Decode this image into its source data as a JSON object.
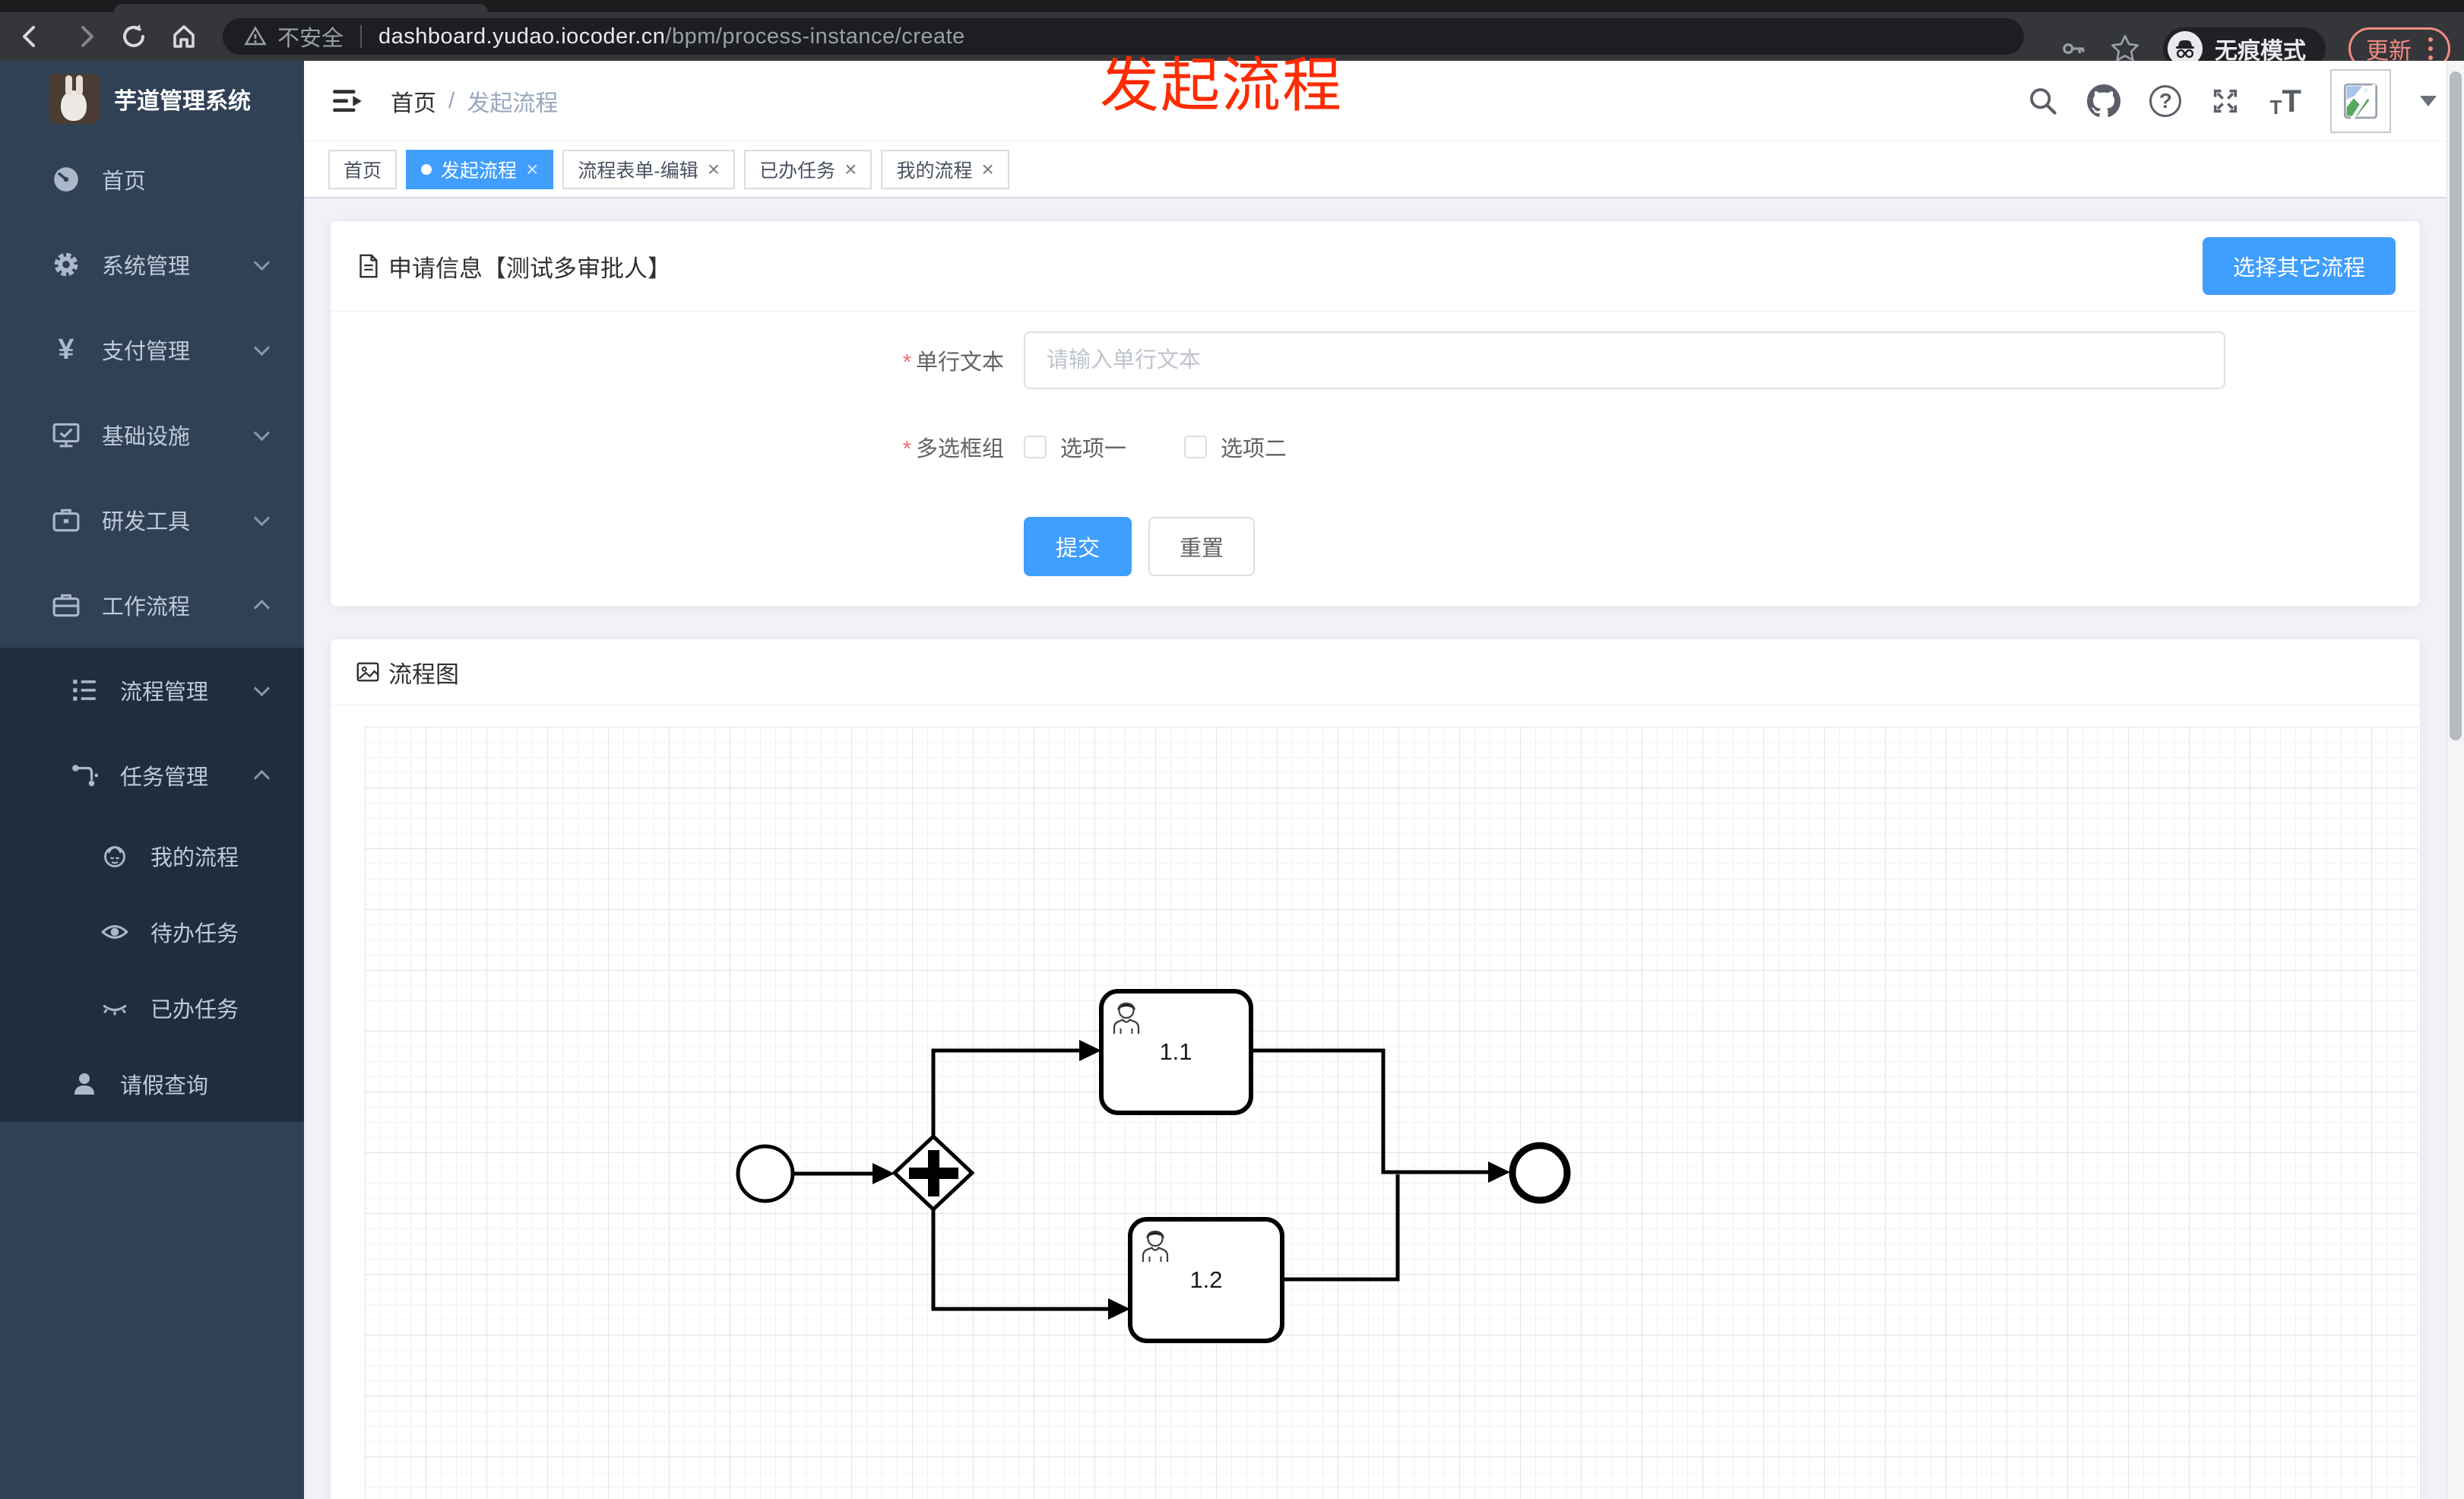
{
  "browser": {
    "security_label": "不安全",
    "url_domain": "dashboard.yudao.iocoder.cn",
    "url_path": "/bpm/process-instance/create",
    "incognito_label": "无痕模式",
    "update_label": "更新"
  },
  "annotation": {
    "text": "发起流程"
  },
  "colors": {
    "accent": "#409eff",
    "danger": "#f56c6c",
    "annotation_red": "#fe2b00",
    "sidebar_bg": "#304156",
    "submenu_bg": "#1f2d3d",
    "active_tab_bg": "#409eff"
  },
  "icons": {
    "question": "?",
    "close": "×",
    "yen": "¥",
    "font_t": "T"
  },
  "sidebar": {
    "app_title": "芋道管理系统",
    "menu": [
      {
        "label": "首页",
        "level": 1,
        "icon": "dashboard-icon"
      },
      {
        "label": "系统管理",
        "level": 1,
        "icon": "gear-icon",
        "state": "collapsed"
      },
      {
        "label": "支付管理",
        "level": 1,
        "icon": "yen-icon",
        "state": "collapsed"
      },
      {
        "label": "基础设施",
        "level": 1,
        "icon": "monitor-icon",
        "state": "collapsed"
      },
      {
        "label": "研发工具",
        "level": 1,
        "icon": "toolbox-icon",
        "state": "collapsed"
      },
      {
        "label": "工作流程",
        "level": 1,
        "icon": "briefcase-icon",
        "state": "expanded"
      },
      {
        "label": "流程管理",
        "level": 2,
        "icon": "tree-list-icon",
        "state": "collapsed"
      },
      {
        "label": "任务管理",
        "level": 2,
        "icon": "flow-icon",
        "state": "expanded"
      },
      {
        "label": "我的流程",
        "level": 3,
        "icon": "people-icon"
      },
      {
        "label": "待办任务",
        "level": 3,
        "icon": "eye-open-icon"
      },
      {
        "label": "已办任务",
        "level": 3,
        "icon": "eye-closed-icon"
      },
      {
        "label": "请假查询",
        "level": 2,
        "icon": "user-icon"
      }
    ]
  },
  "header": {
    "breadcrumb": [
      "首页",
      "发起流程"
    ],
    "breadcrumb_separator": "/"
  },
  "tabs": [
    {
      "label": "首页",
      "active": false,
      "closable": false
    },
    {
      "label": "发起流程",
      "active": true,
      "closable": true
    },
    {
      "label": "流程表单-编辑",
      "active": false,
      "closable": true
    },
    {
      "label": "已办任务",
      "active": false,
      "closable": true
    },
    {
      "label": "我的流程",
      "active": false,
      "closable": true
    }
  ],
  "form_card": {
    "title": "申请信息【测试多审批人】",
    "other_button": "选择其它流程",
    "required_mark": "*",
    "fields": [
      {
        "label": "单行文本",
        "required": true,
        "type": "text",
        "value": "",
        "placeholder": "请输入单行文本"
      },
      {
        "label": "多选框组",
        "required": true,
        "type": "checkbox-group",
        "options": [
          "选项一",
          "选项二"
        ],
        "checked": []
      }
    ],
    "submit_label": "提交",
    "reset_label": "重置"
  },
  "diagram_card": {
    "title": "流程图",
    "type": "bpmn",
    "nodes": [
      {
        "kind": "start-event"
      },
      {
        "kind": "parallel-gateway"
      },
      {
        "kind": "user-task",
        "label": "1.1"
      },
      {
        "kind": "user-task",
        "label": "1.2"
      },
      {
        "kind": "end-event"
      }
    ],
    "tasks": [
      {
        "label": "1.1"
      },
      {
        "label": "1.2"
      }
    ],
    "flows": [
      "start → gateway",
      "gateway → 1.1",
      "gateway → 1.2",
      "1.1 → end",
      "1.2 → end"
    ]
  }
}
